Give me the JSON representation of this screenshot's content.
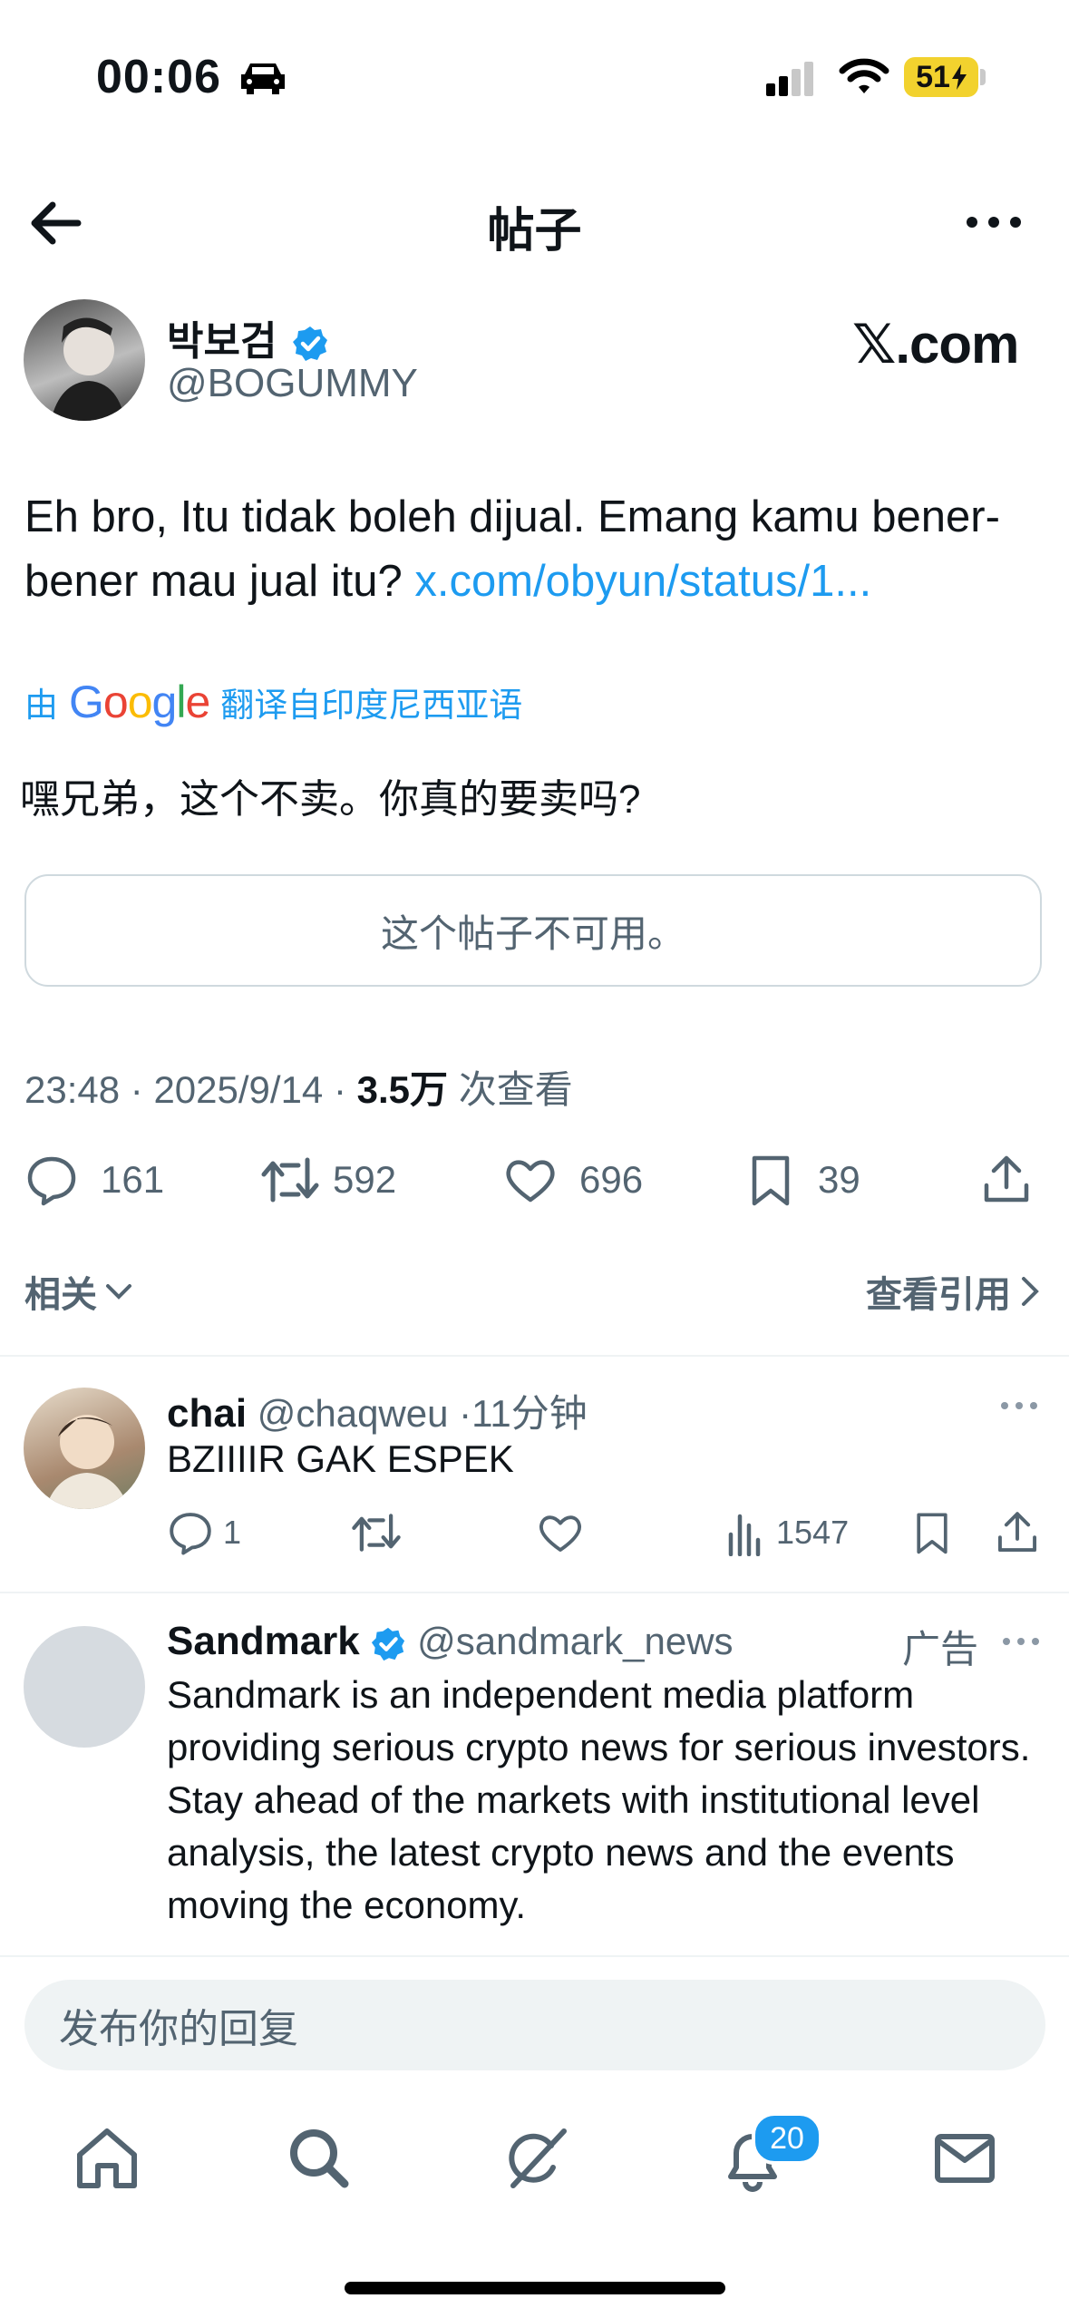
{
  "status_bar": {
    "time": "00:06",
    "battery": "51"
  },
  "header": {
    "title": "帖子"
  },
  "post": {
    "author_name": "박보검",
    "author_handle": "@BOGUMMY",
    "brand": "𝕏.com",
    "text_prefix": "Eh bro, Itu tidak boleh dijual. Emang kamu bener-bener mau jual itu? ",
    "link": "x.com/obyun/status/1...",
    "translate_by": "由",
    "translate_brand": "Google",
    "translate_from": "翻译自印度尼西亚语",
    "translated_text": "嘿兄弟，这个不卖。你真的要卖吗?",
    "quoted_unavailable": "这个帖子不可用。",
    "time": "23:48",
    "date": "2025/9/14",
    "views_count": "3.5万",
    "views_label": "次查看",
    "replies": "161",
    "reposts": "592",
    "likes": "696",
    "bookmarks": "39",
    "related_label": "相关",
    "quotes_label": "查看引用"
  },
  "reply": {
    "name": "chai",
    "handle": "@chaqweu",
    "time": "11分钟",
    "text": "BZIIIIR GAK ESPEK",
    "replies": "1",
    "views": "1547"
  },
  "ad": {
    "name": "Sandmark",
    "handle": "@sandmark_news",
    "label": "广告",
    "text": "Sandmark is an independent media platform providing serious crypto news for serious investors.  Stay ahead of the markets with institutional level analysis, the latest crypto news and the events moving the economy."
  },
  "composer": {
    "placeholder": "发布你的回复"
  },
  "tabbar": {
    "notifications_badge": "20"
  },
  "colors": {
    "accent": "#1d9bf0",
    "muted": "#536471",
    "text": "#0f1419"
  }
}
